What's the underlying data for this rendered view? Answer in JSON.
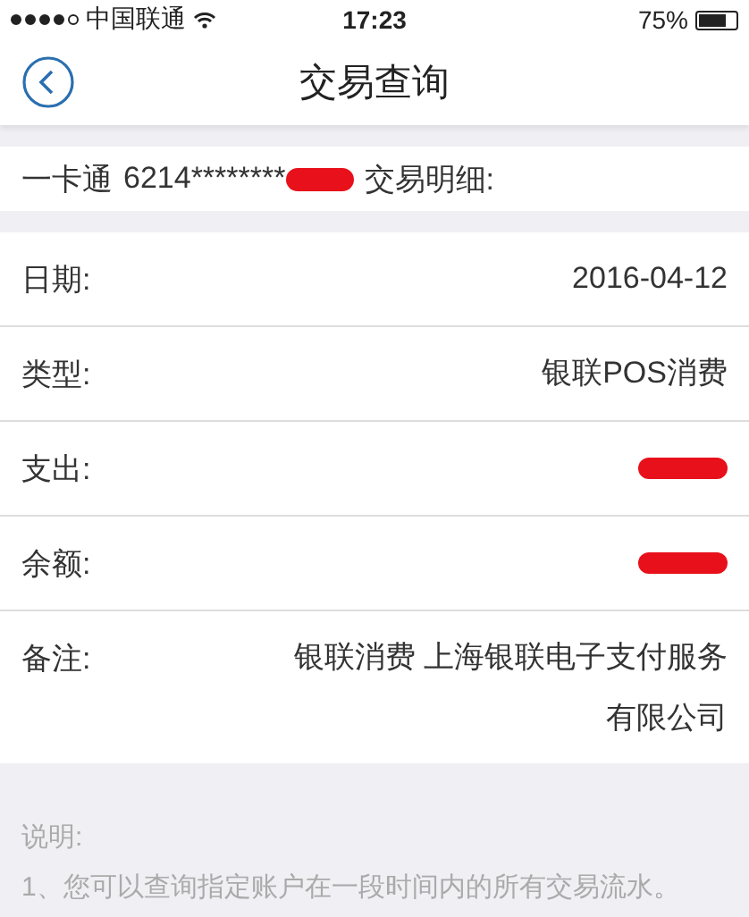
{
  "status_bar": {
    "carrier": "中国联通",
    "time": "17:23",
    "battery": "75%"
  },
  "nav": {
    "title": "交易查询"
  },
  "card_line": {
    "prefix": "一卡通",
    "number": "6214********",
    "redacted": true,
    "suffix": "交易明细:"
  },
  "details": [
    {
      "label": "日期:",
      "value": "2016-04-12",
      "redacted": false
    },
    {
      "label": "类型:",
      "value": "银联POS消费",
      "redacted": false
    },
    {
      "label": "支出:",
      "redacted": true
    },
    {
      "label": "余额:",
      "redacted": true
    },
    {
      "label": "备注:",
      "value": "银联消费 上海银联电子支付服务有限公司",
      "redacted": false
    }
  ],
  "notes": {
    "title": "说明:",
    "items": [
      "1、您可以查询指定账户在一段时间内的所有交易流水。"
    ]
  }
}
